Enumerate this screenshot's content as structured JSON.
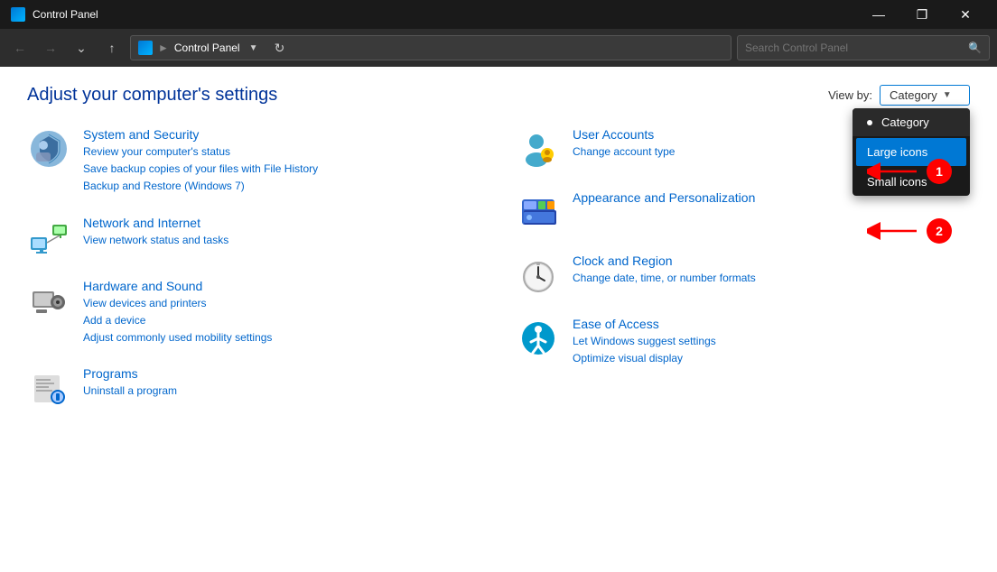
{
  "titleBar": {
    "title": "Control Panel",
    "minBtn": "—",
    "maxBtn": "❐",
    "closeBtn": "✕"
  },
  "addressBar": {
    "backArrow": "←",
    "forwardArrow": "→",
    "downArrow": "∨",
    "upArrow": "↑",
    "breadcrumb": "Control Panel",
    "refreshBtn": "↻",
    "searchPlaceholder": "Search Control Panel"
  },
  "page": {
    "title": "Adjust your computer's settings",
    "viewByLabel": "View by:",
    "viewByValue": "Category"
  },
  "viewByDropdown": {
    "options": [
      {
        "label": "Category",
        "selected": true,
        "highlighted": false
      },
      {
        "label": "Large icons",
        "selected": false,
        "highlighted": true
      },
      {
        "label": "Small icons",
        "selected": false,
        "highlighted": false
      }
    ]
  },
  "categories": {
    "left": [
      {
        "id": "system-security",
        "title": "System and Security",
        "links": [
          "Review your computer's status",
          "Save backup copies of your files with File History",
          "Backup and Restore (Windows 7)"
        ]
      },
      {
        "id": "network-internet",
        "title": "Network and Internet",
        "links": [
          "View network status and tasks"
        ]
      },
      {
        "id": "hardware-sound",
        "title": "Hardware and Sound",
        "links": [
          "View devices and printers",
          "Add a device",
          "Adjust commonly used mobility settings"
        ]
      },
      {
        "id": "programs",
        "title": "Programs",
        "links": [
          "Uninstall a program"
        ]
      }
    ],
    "right": [
      {
        "id": "user-accounts",
        "title": "User Accounts",
        "links": [
          "Change account type"
        ]
      },
      {
        "id": "appearance",
        "title": "Appearance and Personalization",
        "links": []
      },
      {
        "id": "clock-region",
        "title": "Clock and Region",
        "links": [
          "Change date, time, or number formats"
        ]
      },
      {
        "id": "ease-access",
        "title": "Ease of Access",
        "links": [
          "Let Windows suggest settings",
          "Optimize visual display"
        ]
      }
    ]
  }
}
